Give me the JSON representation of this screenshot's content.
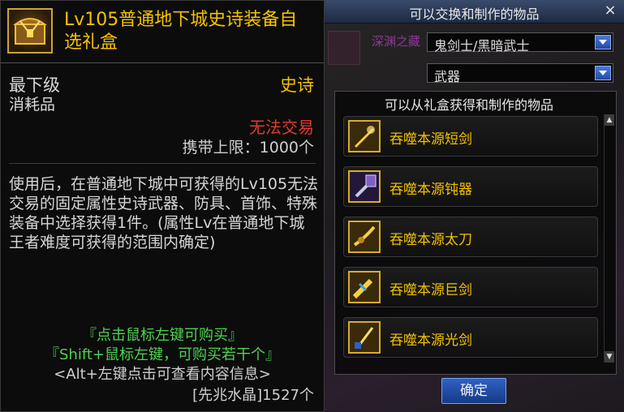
{
  "tooltip": {
    "title": "Lv105普通地下城史诗装备自选礼盒",
    "icon": "treasure-box-icon",
    "grade": "最下级",
    "item_type": "消耗品",
    "rarity": "史诗",
    "trade": "无法交易",
    "carry_limit": "携带上限：1000个",
    "description": "使用后，在普通地下城中可获得的Lv105无法交易的固定属性史诗武器、防具、首饰、特殊装备中选择获得1件。(属性Lv在普通地下城王者难度可获得的范围内确定)",
    "hint1": "『点击鼠标左键可购买』",
    "hint2": "『Shift+鼠标左键，可购买若干个』",
    "hint3": "<Alt+左键点击可查看内容信息>",
    "cost": "[先兆水晶]1527个",
    "colors": {
      "title": "#f3c200",
      "rarity": "#f3c200",
      "trade": "#e23a2a",
      "hint": "#4fd24f"
    }
  },
  "panel": {
    "title": "可以交换和制作的物品",
    "close": "×",
    "behind_label": "深渊之藏",
    "class_select": "鬼剑士/黑暗武士",
    "category_select": "武器",
    "list_title": "可以从礼盒获得和制作的物品",
    "items": [
      {
        "label": "吞噬本源短剑",
        "icon": "short-sword-icon"
      },
      {
        "label": "吞噬本源钝器",
        "icon": "blunt-weapon-icon"
      },
      {
        "label": "吞噬本源太刀",
        "icon": "katana-icon"
      },
      {
        "label": "吞噬本源巨剑",
        "icon": "greatsword-icon"
      },
      {
        "label": "吞噬本源光剑",
        "icon": "lightsaber-icon"
      }
    ],
    "confirm": "确定"
  }
}
